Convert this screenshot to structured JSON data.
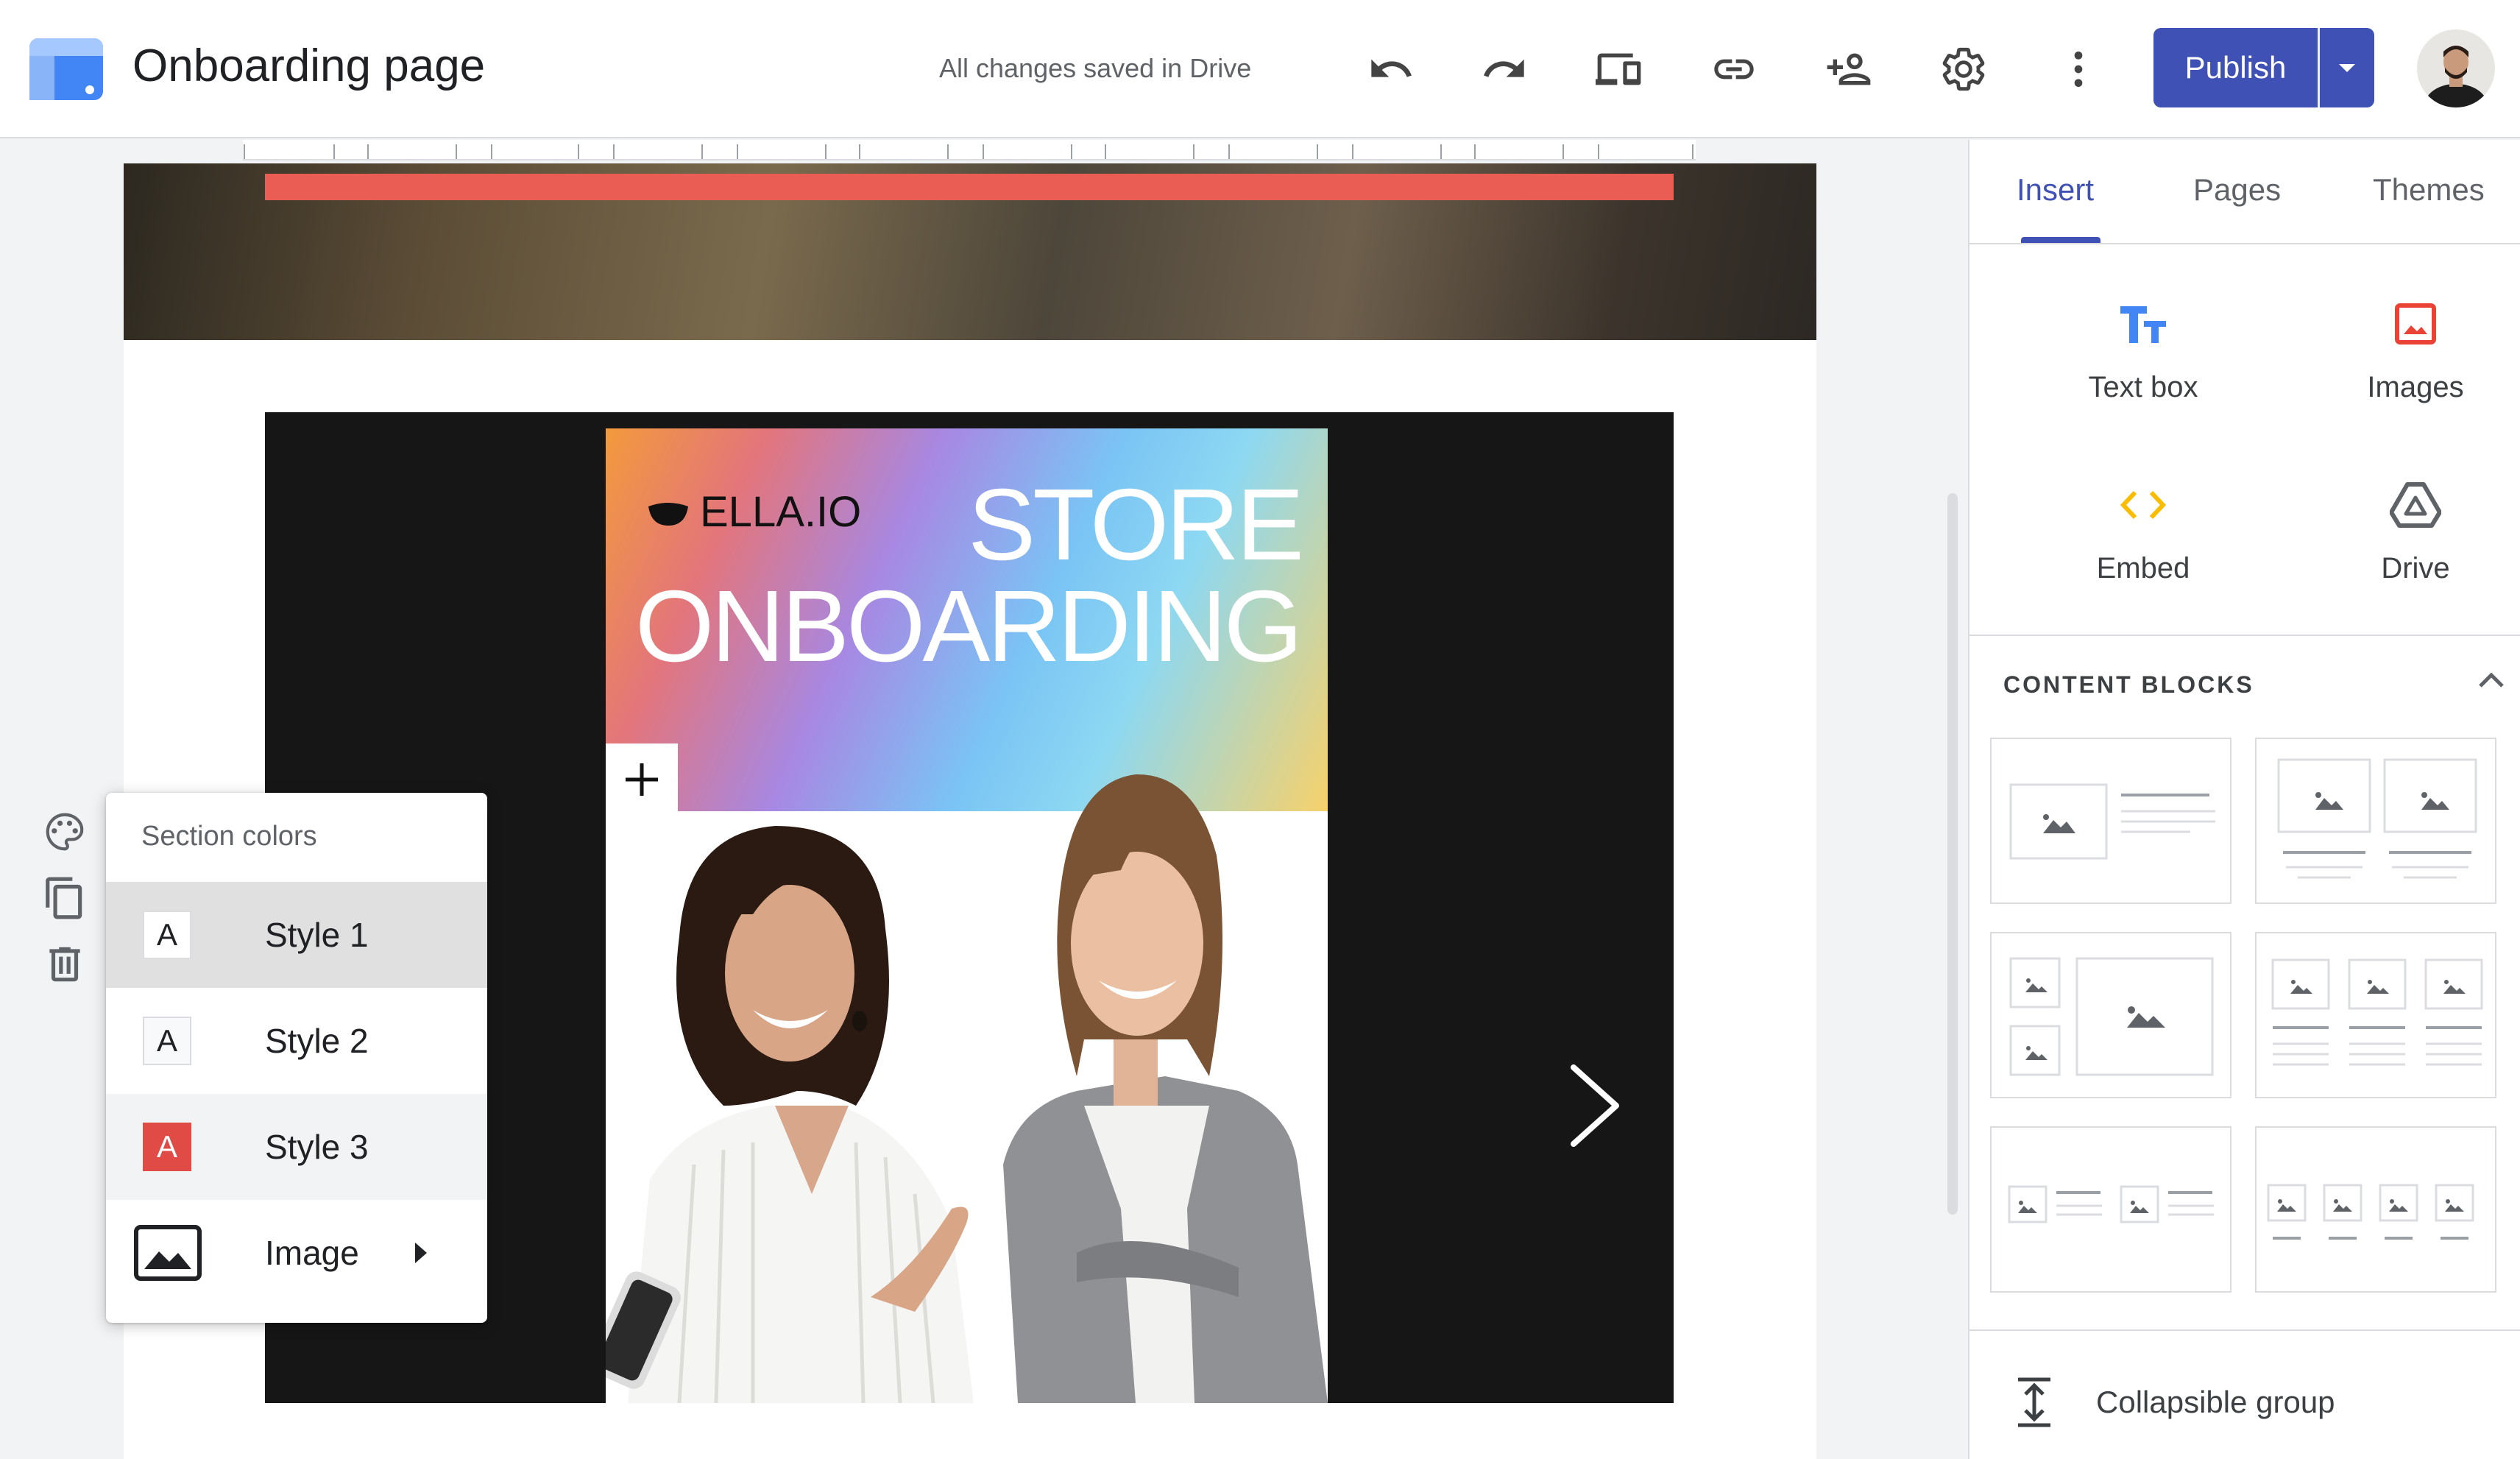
{
  "header": {
    "title": "Onboarding page",
    "save_status": "All changes saved in Drive",
    "publish_label": "Publish",
    "icons": [
      "undo-icon",
      "redo-icon",
      "preview-devices-icon",
      "link-icon",
      "share-icon",
      "settings-icon",
      "more-vert-icon"
    ]
  },
  "slide": {
    "brand": "ELLA.IO",
    "headline_1": "STORE",
    "headline_2": "ONBOARDING"
  },
  "section_menu": {
    "title": "Section colors",
    "items": [
      {
        "swatch": "A",
        "label": "Style 1",
        "selected": true
      },
      {
        "swatch": "A",
        "label": "Style 2",
        "selected": false
      },
      {
        "swatch": "A",
        "label": "Style 3",
        "selected": false
      },
      {
        "label": "Image",
        "has_submenu": true
      }
    ]
  },
  "panel": {
    "tabs": [
      {
        "label": "Insert",
        "active": true
      },
      {
        "label": "Pages",
        "active": false
      },
      {
        "label": "Themes",
        "active": false
      }
    ],
    "insert_items": [
      {
        "label": "Text box",
        "icon": "text-box-icon"
      },
      {
        "label": "Images",
        "icon": "image-icon"
      },
      {
        "label": "Embed",
        "icon": "embed-icon"
      },
      {
        "label": "Drive",
        "icon": "drive-icon"
      }
    ],
    "content_blocks_title": "CONTENT BLOCKS",
    "collapsible_label": "Collapsible group"
  },
  "colors": {
    "accent": "#3f51b5",
    "header_bar": "#ea5d55",
    "style3_swatch": "#e04b45"
  }
}
